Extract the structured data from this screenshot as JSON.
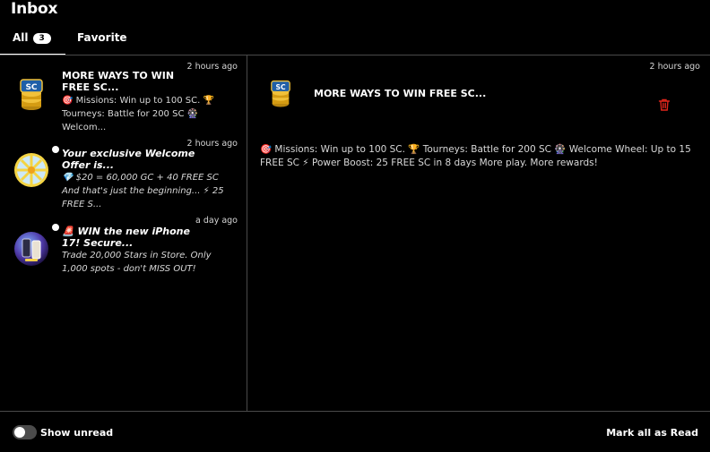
{
  "header": {
    "title": "Inbox"
  },
  "tabs": [
    {
      "label": "All",
      "count": "3"
    },
    {
      "label": "Favorite"
    }
  ],
  "messages": [
    {
      "time": "2 hours ago",
      "title": "MORE WAYS TO WIN FREE SC...",
      "body": "🎯 Missions: Win up to 100 SC. 🏆 Tourneys: Battle for 200 SC 🎡 Welcom...",
      "icon": "sc-coins-icon",
      "unread": false
    },
    {
      "time": "2 hours ago",
      "title": "Your exclusive Welcome Offer is...",
      "body": "💎 $20 = 60,000 GC + 40 FREE SC And that's just the beginning... ⚡ 25 FREE S...",
      "icon": "prize-wheel-icon",
      "unread": true
    },
    {
      "time": "a day ago",
      "title": "🚨 WIN the new iPhone 17! Secure...",
      "body": "Trade 20,000 Stars in Store. Only 1,000 spots - don't MISS OUT!",
      "icon": "iphone-promo-icon",
      "unread": true
    }
  ],
  "detail": {
    "time": "2 hours ago",
    "title": "MORE WAYS TO WIN FREE SC...",
    "body": "🎯 Missions: Win up to 100 SC. 🏆 Tourneys: Battle for 200 SC 🎡 Welcome Wheel: Up to 15 FREE SC ⚡ Power Boost: 25 FREE SC in 8 days More play. More rewards!"
  },
  "footer": {
    "show_unread_label": "Show unread",
    "mark_all_label": "Mark all as Read"
  },
  "colors": {
    "background": "#000000",
    "divider": "#4a4a4a",
    "delete": "#e0251b",
    "coin": "#e8b21a",
    "wheel": "#f2d24a",
    "toggle_off": "#4b4b4b"
  }
}
